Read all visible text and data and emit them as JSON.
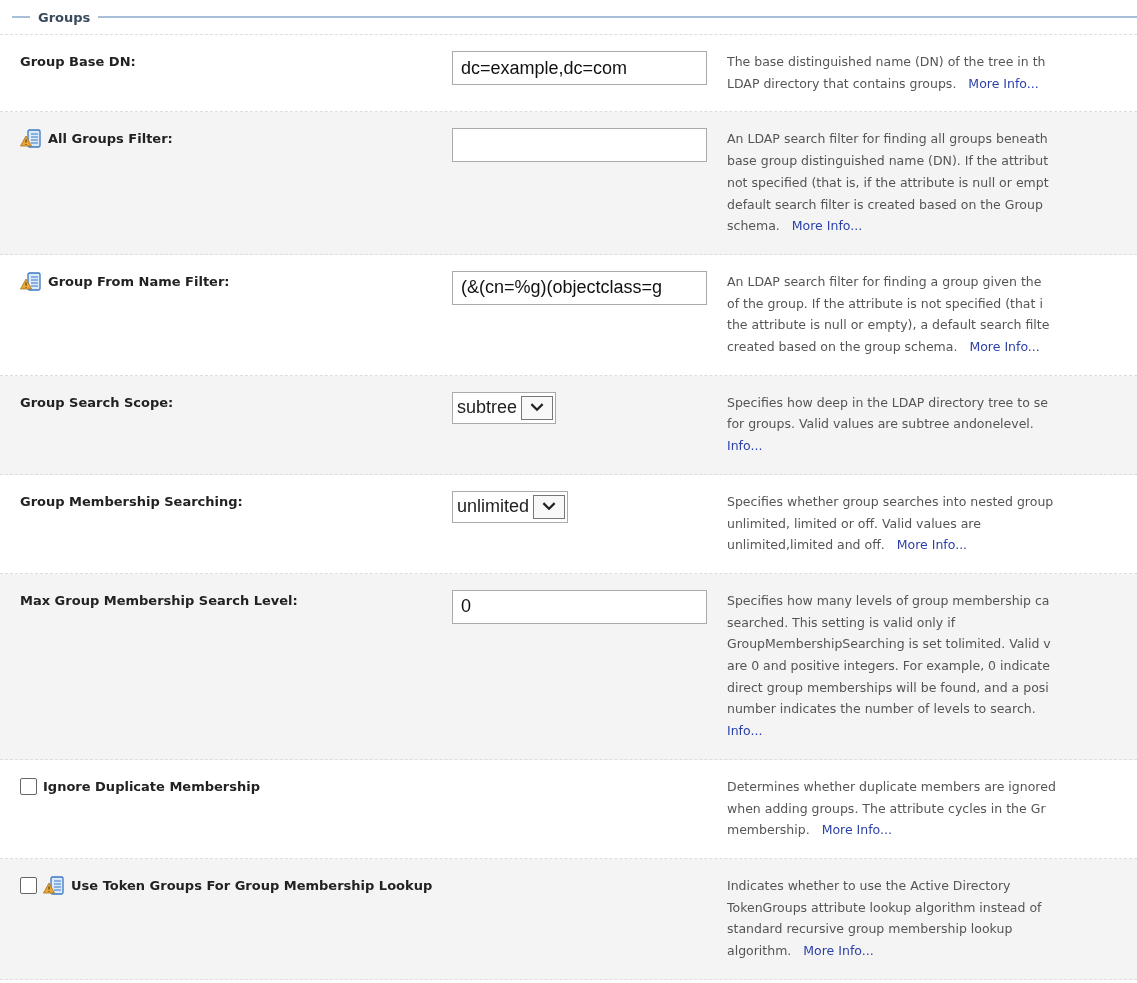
{
  "section": {
    "title": "Groups"
  },
  "rows": [
    {
      "kind": "text",
      "label": "Group Base DN:",
      "icon": false,
      "value": "dc=example,dc=com",
      "description": {
        "lines": [
          "The base distinguished name (DN) of the tree in th",
          "LDAP directory that contains groups."
        ],
        "link": "More Info...",
        "link_inline": true
      }
    },
    {
      "kind": "text",
      "label": "All Groups Filter:",
      "icon": true,
      "value": "",
      "description": {
        "lines": [
          "An LDAP search filter for finding all groups beneath",
          "base group distinguished name (DN). If the attribut",
          "not specified (that is, if the attribute is null or empt",
          "default search filter is created based on the Group",
          "schema."
        ],
        "link": "More Info...",
        "link_inline": true
      }
    },
    {
      "kind": "text",
      "label": "Group From Name Filter:",
      "icon": true,
      "value": "(&(cn=%g)(objectclass=g",
      "description": {
        "lines": [
          "An LDAP search filter for finding a group given the",
          "of the group. If the attribute is not specified (that i",
          "the attribute is null or empty), a default search filte",
          "created based on the group schema."
        ],
        "link": "More Info...",
        "link_inline": true
      }
    },
    {
      "kind": "select",
      "label": "Group Search Scope:",
      "icon": false,
      "value": "subtree",
      "description": {
        "lines": [
          "Specifies how deep in the LDAP directory tree to se",
          "for groups. Valid values are subtree andonelevel."
        ],
        "link": "Info...",
        "link_inline": false
      }
    },
    {
      "kind": "select",
      "label": "Group Membership Searching:",
      "icon": false,
      "value": "unlimited",
      "description": {
        "lines": [
          "Specifies whether group searches into nested group",
          "unlimited, limited or off. Valid values are",
          "unlimited,limited and off."
        ],
        "link": "More Info...",
        "link_inline": true
      }
    },
    {
      "kind": "text",
      "label": "Max Group Membership Search Level:",
      "icon": false,
      "value": "0",
      "description": {
        "lines": [
          "Specifies how many levels of group membership ca",
          "searched. This setting is valid only if",
          "GroupMembershipSearching is set tolimited. Valid v",
          "are 0 and positive integers. For example, 0 indicate",
          "direct group memberships will be found, and a posi",
          "number indicates the number of levels to search."
        ],
        "link": "Info...",
        "link_inline": false
      }
    },
    {
      "kind": "checkbox",
      "label": "Ignore Duplicate Membership",
      "icon": false,
      "checked": false,
      "description": {
        "lines": [
          "Determines whether duplicate members are ignored",
          "when adding groups. The attribute cycles in the Gr",
          "membership."
        ],
        "link": "More Info...",
        "link_inline": true
      }
    },
    {
      "kind": "checkbox",
      "label": "Use Token Groups For Group Membership Lookup",
      "icon": true,
      "checked": false,
      "description": {
        "lines": [
          "Indicates whether to use the Active Directory",
          "TokenGroups attribute lookup algorithm instead of",
          "standard recursive group membership lookup",
          "algorithm."
        ],
        "link": "More Info...",
        "link_inline": true
      }
    }
  ]
}
